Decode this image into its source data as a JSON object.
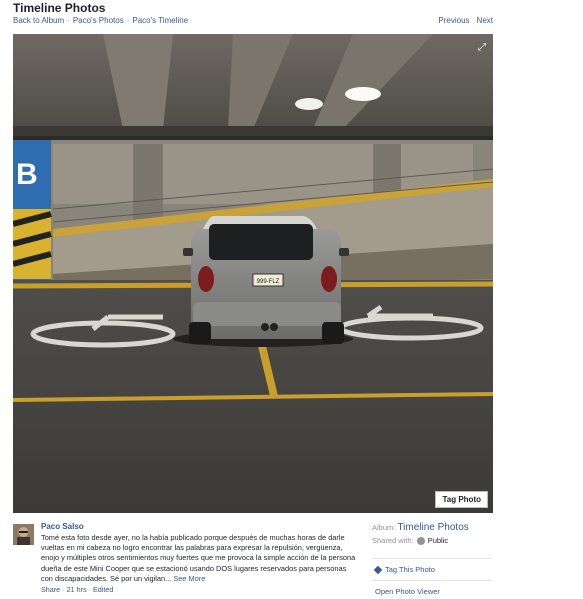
{
  "header": {
    "title": "Timeline Photos",
    "breadcrumbs": [
      "Back to Album",
      "Paco's Photos",
      "Paco's Timeline"
    ],
    "separator": "·",
    "previous": "Previous",
    "next": "Next"
  },
  "photo": {
    "tag_button": "Tag Photo",
    "plate_text": "999-FLZ"
  },
  "post": {
    "author": "Paco Salso",
    "caption": "Tomé esta foto desde ayer, no la había publicado porque después de muchas horas de darle vueltas en mi cabeza no logro encontrar las palabras para expresar la repulsión, vergüenza, enojo y múltiples otros sentimientos muy fuertes que me provoca la simple acción de la persona dueña de este Mini Cooper que se estacionó usando DOS lugares reservados para personas con discapacidades. Sé por un vigilan...",
    "see_more": "See More",
    "share": "Share",
    "time": "21 hrs",
    "edited": "Edited"
  },
  "sidebar": {
    "album_label": "Album:",
    "album_name": "Timeline Photos",
    "shared_label": "Shared with:",
    "shared_value": "Public",
    "tag_this_photo": "Tag This Photo",
    "open_viewer": "Open Photo Viewer"
  },
  "colors": {
    "link": "#365899",
    "muted": "#90949c",
    "text": "#1d2129"
  }
}
